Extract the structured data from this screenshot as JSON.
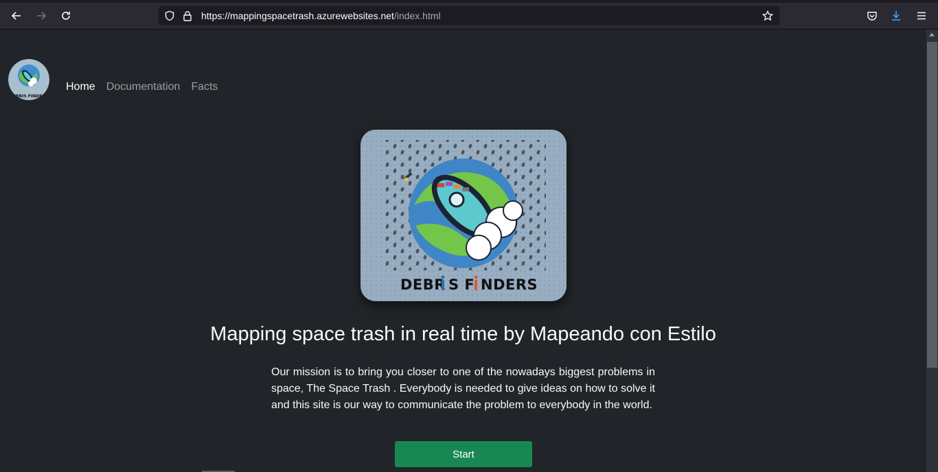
{
  "browser": {
    "url_host": "https://mappingspacetrash.azurewebsites.net",
    "url_path": "/index.html"
  },
  "nav": {
    "items": [
      {
        "label": "Home",
        "active": true
      },
      {
        "label": "Documentation",
        "active": false
      },
      {
        "label": "Facts",
        "active": false
      }
    ]
  },
  "hero": {
    "logo_text_left": "DEBR",
    "logo_text_mid": "S F",
    "logo_text_right": "NDERS",
    "title": "Mapping space trash in real time by Mapeando con Estilo",
    "mission": "Our mission is to bring you closer to one of the nowadays biggest problems in space, The Space Trash . Everybody is needed to give ideas on how to solve it and this site is our way to communicate the problem to everybody in the world.",
    "start_label": "Start"
  },
  "colors": {
    "page_bg": "#212529",
    "button_green": "#198754",
    "download_accent": "#45a1ff"
  },
  "icons": [
    "back-icon",
    "forward-icon",
    "reload-icon",
    "shield-icon",
    "lock-icon",
    "star-icon",
    "pocket-icon",
    "download-icon",
    "menu-icon"
  ]
}
